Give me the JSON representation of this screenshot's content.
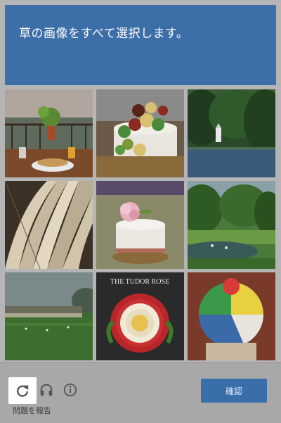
{
  "challenge": {
    "instruction": "草の画像をすべて選択します。",
    "header_color": "#3c6ea8",
    "tiles": [
      {
        "id": 1,
        "subject": "dining table with plant and breakfast"
      },
      {
        "id": 2,
        "subject": "cake with sugar roses"
      },
      {
        "id": 3,
        "subject": "lake with trees and white tower"
      },
      {
        "id": 4,
        "subject": "open book pages"
      },
      {
        "id": 5,
        "subject": "white cake with pink flower"
      },
      {
        "id": 6,
        "subject": "park pond with trees"
      },
      {
        "id": 7,
        "subject": "stadium field"
      },
      {
        "id": 8,
        "subject": "the tudor rose cake"
      },
      {
        "id": 9,
        "subject": "beach ball cake"
      }
    ],
    "tile8_caption": "THE TUDOR ROSE"
  },
  "footer": {
    "reload_icon": "reload-icon",
    "audio_icon": "headphones-icon",
    "info_icon": "info-icon",
    "report_label": "問題を報告",
    "verify_label": "確認",
    "verify_color": "#3a6ea9"
  }
}
